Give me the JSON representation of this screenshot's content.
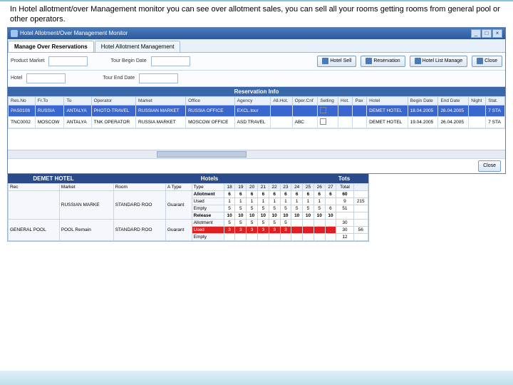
{
  "caption": "In Hotel allotment/over Management monitor you can see over allotment sales, you can sell all your rooms getting rooms from general pool or other operators.",
  "window": {
    "title": "Hotel Allotment/Over Management Monitor",
    "tabs": [
      "Manage Over Reservations",
      "Hotel Allotment Management"
    ]
  },
  "filters": {
    "productMarket": "Product Market",
    "hotel": "Hotel",
    "tourBegin": "Tour Begin Date",
    "tourEnd": "Tour End Date",
    "buttons": {
      "sell": "Hotel Sell",
      "reservation": "Reservation",
      "listManage": "Hotel List Manage",
      "close": "Close"
    }
  },
  "resInfo": {
    "header": "Reservation Info",
    "cols": [
      "Res.No",
      "Fr.To",
      "To",
      "Operator",
      "Market",
      "Office",
      "Agency",
      "All.Hot.",
      "Oper.Cnf",
      "Selling",
      "Hot.",
      "Pax",
      "Hotel",
      "Begin Date",
      "End Date",
      "Night",
      "Stat."
    ],
    "rows": [
      [
        "PAS0108",
        "RUSSIA",
        "ANTALYA",
        "PHOTO-TRAVEL",
        "RUSSIAN MARKET",
        "RUSSIA OFFICE",
        "EXCL.tour",
        "",
        "",
        "",
        "",
        "",
        "DEMET HOTEL",
        "18.04.2005",
        "26.04.2005",
        "",
        "7 STA"
      ],
      [
        "TNC0002",
        "MOSCOW",
        "ANTALYA",
        "TNK OPERATOR",
        "RUSSIA MARKET",
        "MOSCOW OFFICE",
        "ASD TRAVEL",
        "",
        "ABC",
        "",
        "",
        "",
        "DEMET HOTEL",
        "19.04.2005",
        "26.04.2005",
        "",
        "7 STA"
      ]
    ]
  },
  "allocPanel": {
    "hotelName": "DEMET HOTEL",
    "hotelsLabel": "Hotels",
    "totsLabel": "Tots",
    "leftCols": [
      "Rec",
      "Market",
      "Room",
      "A Type",
      "Type"
    ],
    "dayCols": [
      "18",
      "19",
      "20",
      "21",
      "22",
      "23",
      "24",
      "25",
      "26",
      "27"
    ],
    "totalCol": "Total",
    "blankCol": "",
    "rows": [
      {
        "left": [
          "",
          "RUSSIAN MARKE",
          "STANDARD ROO",
          "Guarant",
          ""
        ],
        "sub": [
          {
            "label": "Allotment",
            "cls": "bold",
            "vals": [
              "6",
              "6",
              "6",
              "6",
              "6",
              "6",
              "6",
              "6",
              "6",
              "6"
            ],
            "tot": "60",
            "g": ""
          },
          {
            "label": "Used",
            "vals": [
              "1",
              "1",
              "1",
              "1",
              "1",
              "1",
              "1",
              "1",
              "1",
              ""
            ],
            "tot": "9",
            "g": "215"
          },
          {
            "label": "Empty",
            "vals": [
              "5",
              "5",
              "5",
              "5",
              "5",
              "5",
              "5",
              "5",
              "5",
              "6"
            ],
            "tot": "51",
            "g": ""
          },
          {
            "label": "Release",
            "cls": "bold",
            "vals": [
              "10",
              "10",
              "10",
              "10",
              "10",
              "10",
              "10",
              "10",
              "10",
              "10"
            ],
            "tot": "",
            "g": ""
          }
        ]
      },
      {
        "left": [
          "GENERAL POOL",
          "POOL Remain",
          "STANDARD ROO",
          "Guarant",
          ""
        ],
        "sub": [
          {
            "label": "Allotment",
            "vals": [
              "5",
              "5",
              "5",
              "5",
              "5",
              "5",
              "",
              "",
              "",
              ""
            ],
            "tot": "30",
            "g": ""
          },
          {
            "label": "Used",
            "cls": "red",
            "vals": [
              "3",
              "3",
              "3",
              "3",
              "3",
              "3",
              "",
              "",
              "",
              ""
            ],
            "tot": "30",
            "g": "56"
          },
          {
            "label": "Empty",
            "vals": [
              "",
              "",
              "",
              "",
              "",
              "",
              "",
              "",
              "",
              ""
            ],
            "tot": "12",
            "g": ""
          }
        ]
      }
    ]
  }
}
